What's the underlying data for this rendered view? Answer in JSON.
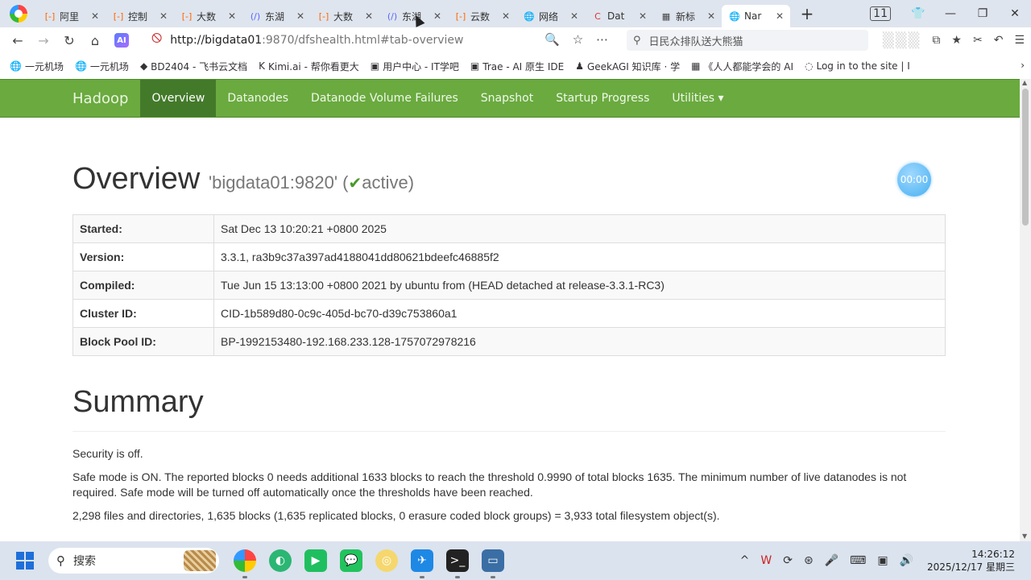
{
  "browser": {
    "tabs": [
      {
        "icon": "[-]",
        "label": "阿里",
        "color": "#f60"
      },
      {
        "icon": "[-]",
        "label": "控制",
        "color": "#f60"
      },
      {
        "icon": "[-]",
        "label": "大数",
        "color": "#f60"
      },
      {
        "icon": "(/)",
        "label": "东湖",
        "color": "#56f"
      },
      {
        "icon": "[-]",
        "label": "大数",
        "color": "#f60"
      },
      {
        "icon": "(/)",
        "label": "东湖",
        "color": "#56f"
      },
      {
        "icon": "[-]",
        "label": "云数",
        "color": "#f60"
      },
      {
        "icon": "🌐",
        "label": "网络",
        "color": "#444"
      },
      {
        "icon": "C",
        "label": "Dat",
        "color": "#d33"
      },
      {
        "icon": "▦",
        "label": "新标",
        "color": "#444"
      },
      {
        "icon": "🌐",
        "label": "Nar",
        "color": "#444",
        "active": true
      }
    ],
    "tab_count": "11",
    "url_host": "http://bigdata01",
    "url_rest": ":9870/dfshealth.html#tab-overview",
    "search_placeholder": "日民众排队送大熊猫",
    "ai_label": "AI",
    "bookmarks": [
      {
        "icon": "🌐",
        "label": "一元机场"
      },
      {
        "icon": "🌐",
        "label": "一元机场"
      },
      {
        "icon": "◆",
        "label": "BD2404 - 飞书云文档"
      },
      {
        "icon": "K",
        "label": "Kimi.ai - 帮你看更大"
      },
      {
        "icon": "▣",
        "label": "用户中心 - IT学吧"
      },
      {
        "icon": "▣",
        "label": "Trae - AI 原生 IDE"
      },
      {
        "icon": "♟",
        "label": "GeekAGI 知识库 · 学"
      },
      {
        "icon": "▦",
        "label": "《人人都能学会的 AI"
      },
      {
        "icon": "◌",
        "label": "Log in to the site | I"
      }
    ]
  },
  "hadoop_nav": {
    "brand": "Hadoop",
    "items": [
      "Overview",
      "Datanodes",
      "Datanode Volume Failures",
      "Snapshot",
      "Startup Progress",
      "Utilities ▾"
    ]
  },
  "overview": {
    "title": "Overview",
    "subtitle_host": "'bigdata01:9820'",
    "subtitle_open": "(",
    "check": "✔",
    "status": "active",
    "subtitle_close": ")",
    "timer": "00:00",
    "rows": [
      {
        "key": "Started:",
        "value": "Sat Dec 13 10:20:21 +0800 2025"
      },
      {
        "key": "Version:",
        "value": "3.3.1, ra3b9c37a397ad4188041dd80621bdeefc46885f2"
      },
      {
        "key": "Compiled:",
        "value": "Tue Jun 15 13:13:00 +0800 2021 by ubuntu from (HEAD detached at release-3.3.1-RC3)"
      },
      {
        "key": "Cluster ID:",
        "value": "CID-1b589d80-0c9c-405d-bc70-d39c753860a1"
      },
      {
        "key": "Block Pool ID:",
        "value": "BP-1992153480-192.168.233.128-1757072978216"
      }
    ]
  },
  "summary": {
    "title": "Summary",
    "security": "Security is off.",
    "safemode": "Safe mode is ON. The reported blocks 0 needs additional 1633 blocks to reach the threshold 0.9990 of total blocks 1635. The minimum number of live datanodes is not required. Safe mode will be turned off automatically once the thresholds have been reached.",
    "files": "2,298 files and directories, 1,635 blocks (1,635 replicated blocks, 0 erasure coded block groups) = 3,933 total filesystem object(s)."
  },
  "taskbar": {
    "search_label": "搜索",
    "time": "14:26:12",
    "date": "2025/12/17 星期三"
  }
}
